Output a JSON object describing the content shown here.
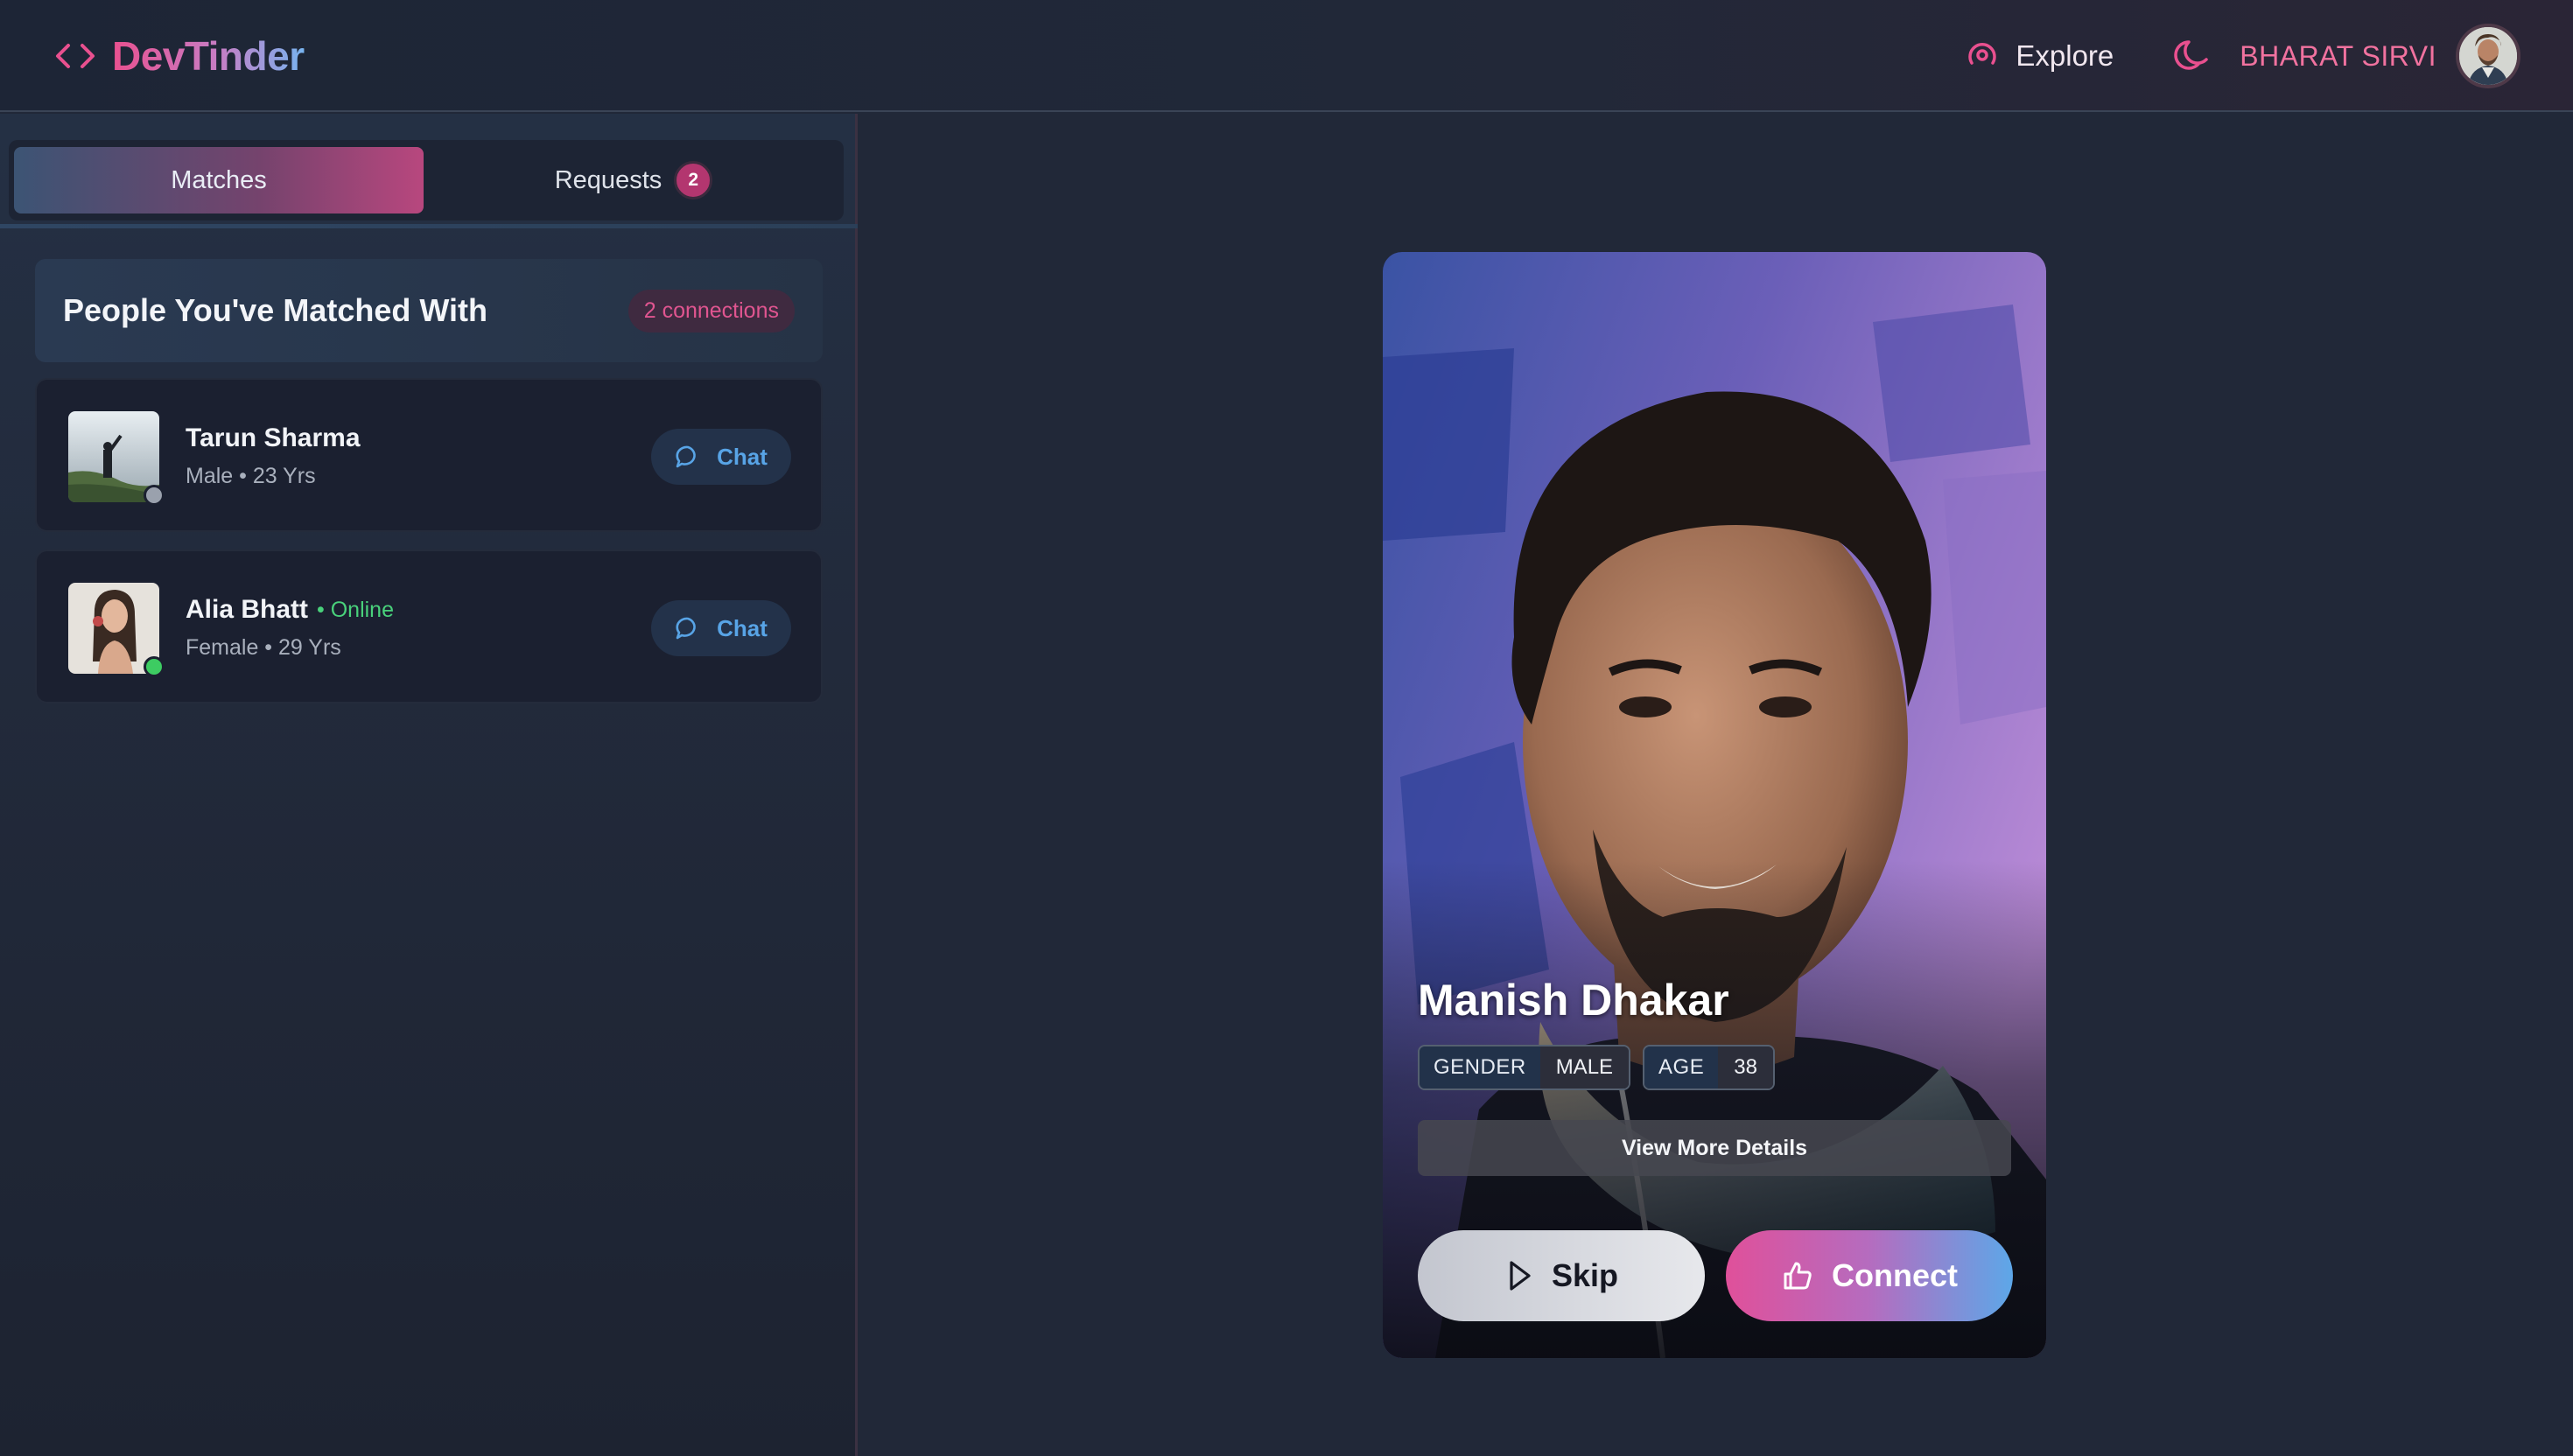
{
  "app": {
    "brand": "DevTinder"
  },
  "nav": {
    "explore_label": "Explore",
    "user_name": "BHARAT SIRVI"
  },
  "tabs": [
    {
      "label": "Matches",
      "active": true
    },
    {
      "label": "Requests",
      "badge": "2",
      "active": false
    }
  ],
  "matches_section": {
    "title": "People You've Matched With",
    "count_label": "2 connections"
  },
  "matches": [
    {
      "name": "Tarun Sharma",
      "status": "",
      "meta": "Male • 23 Yrs",
      "online": false,
      "chat_label": "Chat"
    },
    {
      "name": "Alia Bhatt",
      "status": "• Online",
      "meta": "Female • 29 Yrs",
      "online": true,
      "chat_label": "Chat"
    }
  ],
  "profile": {
    "name": "Manish Dhakar",
    "gender_key": "GENDER",
    "gender_value": "MALE",
    "age_key": "AGE",
    "age_value": "38",
    "view_more_label": "View More Details",
    "skip_label": "Skip",
    "connect_label": "Connect"
  },
  "colors": {
    "accent_pink": "#e9508f",
    "accent_blue": "#58a4e6",
    "online_green": "#3dcc62",
    "background": "#212838"
  },
  "icons": {
    "brand": "code-brackets-icon",
    "explore": "radar-icon",
    "theme": "moon-icon",
    "chat": "chat-bubble-icon",
    "skip": "play-outline-icon",
    "connect": "thumbs-up-icon"
  }
}
